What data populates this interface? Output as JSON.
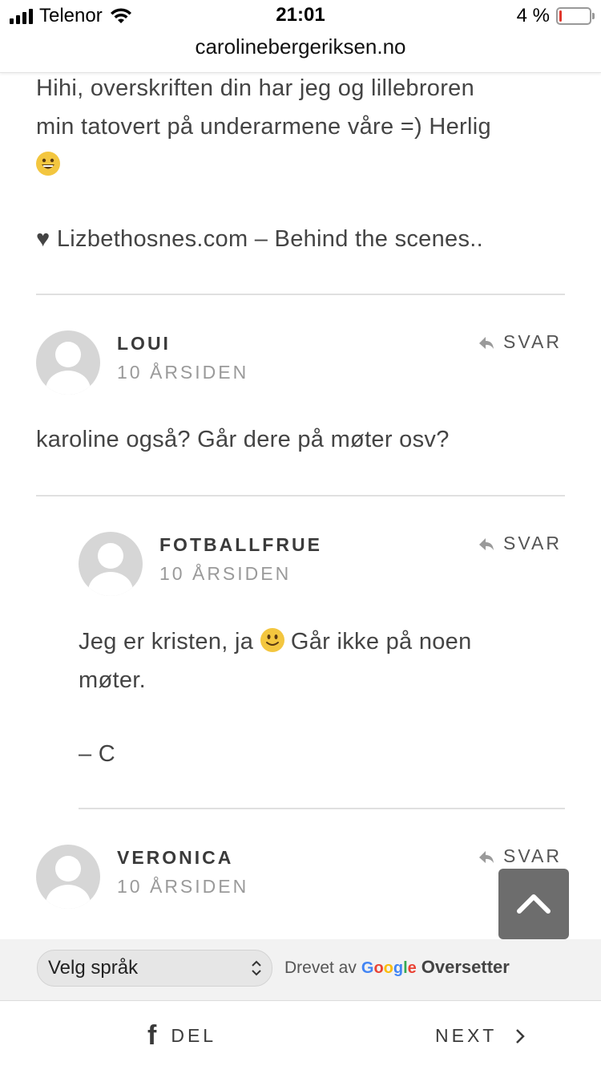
{
  "status_bar": {
    "carrier": "Telenor",
    "time": "21:01",
    "battery": "4 %"
  },
  "browser": {
    "url": "carolinebergeriksen.no"
  },
  "comments": {
    "top_text_line1": "Hihi, overskriften din har jeg og lillebroren",
    "top_text_line2": "min tatovert på underarmene våre =) Herlig",
    "top_link": "♥ Lizbethosnes.com – Behind the scenes..",
    "items": [
      {
        "author": "LOUI",
        "time": "10 ÅRSIDEN",
        "reply": "SVAR",
        "text": "karoline også? Går dere på møter osv?"
      },
      {
        "author": "FOTBALLFRUE",
        "time": "10 ÅRSIDEN",
        "reply": "SVAR",
        "text_a": "Jeg er kristen, ja",
        "text_b": "Går ikke på noen",
        "text_c": "møter.",
        "signature": "– C"
      },
      {
        "author": "VERONICA",
        "time": "10 ÅRSIDEN",
        "reply": "SVAR"
      }
    ]
  },
  "translate": {
    "select_label": "Velg språk",
    "powered_by": "Drevet av",
    "google": "Google",
    "service": "Oversetter"
  },
  "bottom_bar": {
    "share_label": "DEL",
    "next_label": "NEXT"
  },
  "icons": {
    "signal": "signal-bars-icon",
    "wifi": "wifi-icon",
    "battery": "battery-icon",
    "reply": "reply-arrow-icon",
    "scroll_top": "chevron-up-icon",
    "facebook": "facebook-icon",
    "next": "chevron-right-icon"
  },
  "colors": {
    "google_blue": "#4285F4",
    "google_red": "#EA4335",
    "google_yellow": "#FBBC05",
    "google_green": "#34A853",
    "battery_low": "#e0362c"
  }
}
